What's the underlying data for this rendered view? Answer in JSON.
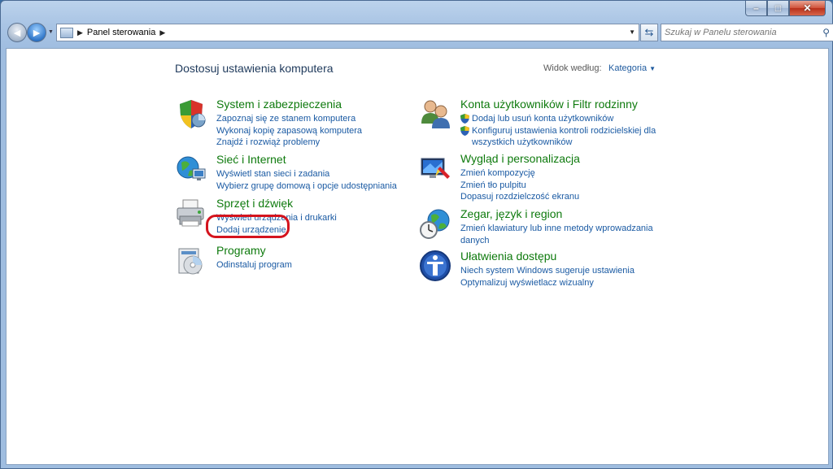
{
  "window": {
    "min_glyph": "–",
    "max_glyph": "□",
    "close_glyph": "✕"
  },
  "nav": {
    "back_glyph": "◄",
    "forward_glyph": "►",
    "address": [
      "Panel sterowania"
    ],
    "search_placeholder": "Szukaj w Panelu sterowania"
  },
  "header": {
    "title": "Dostosuj ustawienia komputera",
    "view_by_label": "Widok według:",
    "view_by_value": "Kategoria"
  },
  "left_categories": [
    {
      "title": "System i zabezpieczenia",
      "icon": "shield-icon",
      "links": [
        {
          "text": "Zapoznaj się ze stanem komputera"
        },
        {
          "text": "Wykonaj kopię zapasową komputera"
        },
        {
          "text": "Znajdź i rozwiąż problemy"
        }
      ]
    },
    {
      "title": "Sieć i Internet",
      "icon": "network-globe-icon",
      "links": [
        {
          "text": "Wyświetl stan sieci i zadania"
        },
        {
          "text": "Wybierz grupę domową i opcje udostępniania"
        }
      ]
    },
    {
      "title": "Sprzęt i dźwięk",
      "icon": "printer-icon",
      "links": [
        {
          "text": "Wyświetl urządzenia i drukarki"
        },
        {
          "text": "Dodaj urządzenie"
        }
      ]
    },
    {
      "title": "Programy",
      "icon": "programs-icon",
      "links": [
        {
          "text": "Odinstaluj program"
        }
      ]
    }
  ],
  "right_categories": [
    {
      "title": "Konta użytkowników i Filtr rodzinny",
      "icon": "users-icon",
      "links": [
        {
          "text": "Dodaj lub usuń konta użytkowników",
          "shield": true
        },
        {
          "text": "Konfiguruj ustawienia kontroli rodzicielskiej dla",
          "shield": true
        },
        {
          "text": "wszystkich użytkowników",
          "shield": false,
          "indent": true
        }
      ]
    },
    {
      "title": "Wygląd i personalizacja",
      "icon": "monitor-paint-icon",
      "links": [
        {
          "text": "Zmień kompozycję"
        },
        {
          "text": "Zmień tło pulpitu"
        },
        {
          "text": "Dopasuj rozdzielczość ekranu"
        }
      ]
    },
    {
      "title": "Zegar, język i region",
      "icon": "clock-globe-icon",
      "links": [
        {
          "text": "Zmień klawiatury lub inne metody wprowadzania"
        },
        {
          "text": "danych"
        }
      ]
    },
    {
      "title": "Ułatwienia dostępu",
      "icon": "accessibility-icon",
      "links": [
        {
          "text": "Niech system Windows sugeruje ustawienia"
        },
        {
          "text": "Optymalizuj wyświetlacz wizualny"
        }
      ]
    }
  ],
  "colors": {
    "category_title": "#0e7a0d",
    "link": "#1a5aa3",
    "highlight": "#d4141e"
  }
}
